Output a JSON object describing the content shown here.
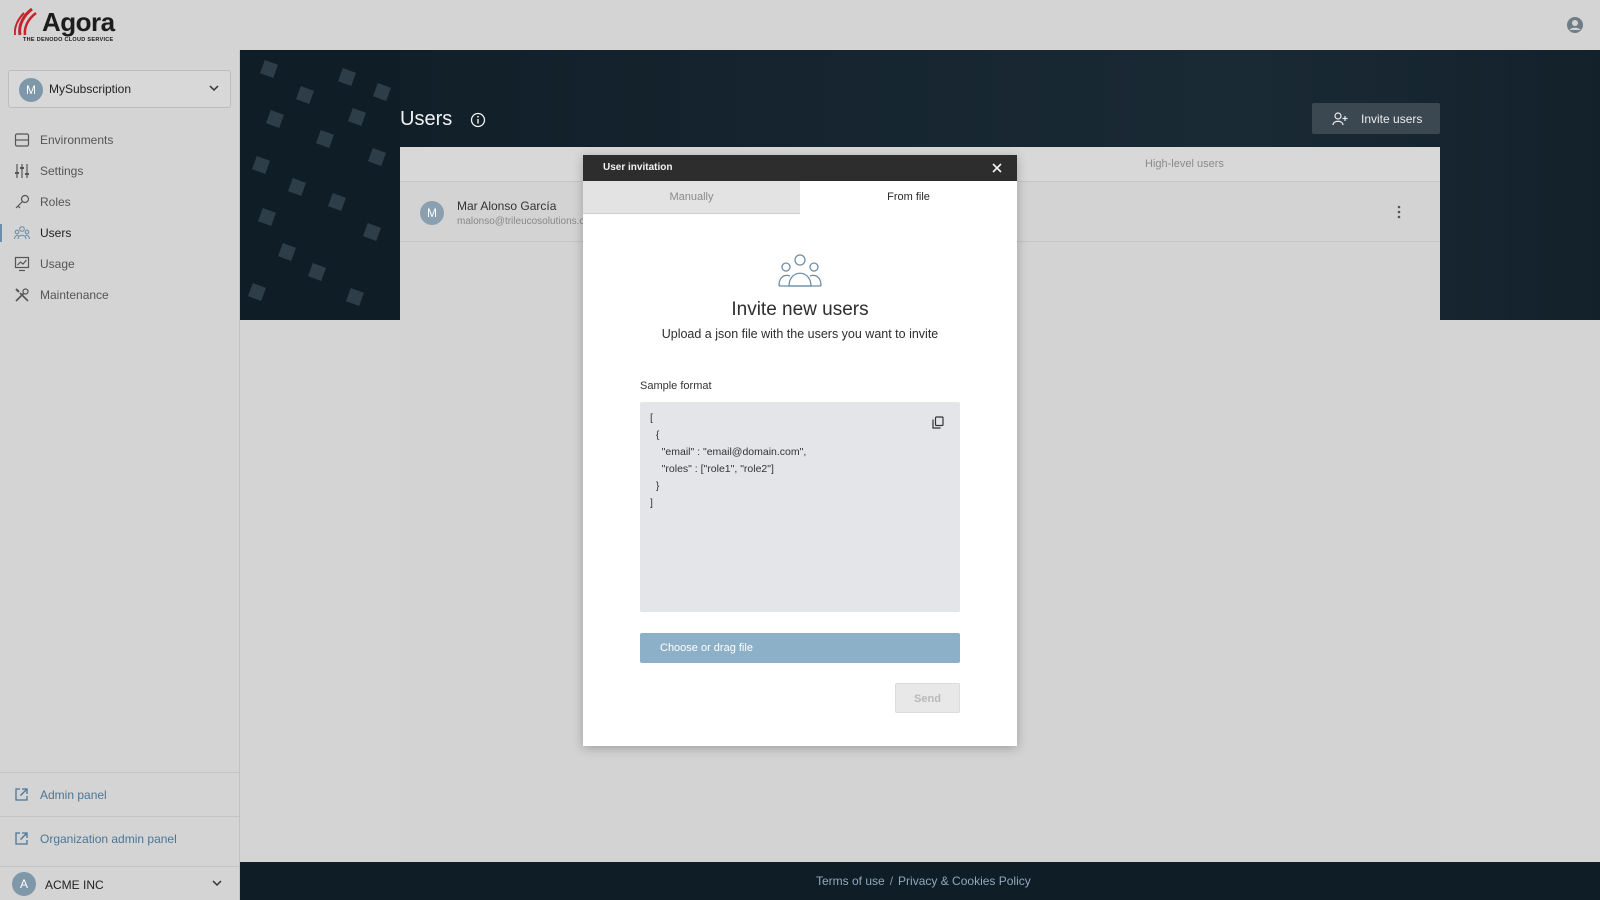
{
  "app": {
    "name": "Agora",
    "tagline": "THE DENODO CLOUD SERVICE"
  },
  "subscription": {
    "avatar": "M",
    "name": "MySubscription"
  },
  "sidebar": {
    "items": [
      {
        "label": "Environments",
        "icon": "environments-icon"
      },
      {
        "label": "Settings",
        "icon": "settings-sliders-icon"
      },
      {
        "label": "Roles",
        "icon": "key-icon"
      },
      {
        "label": "Users",
        "icon": "users-icon",
        "active": true
      },
      {
        "label": "Usage",
        "icon": "usage-chart-icon"
      },
      {
        "label": "Maintenance",
        "icon": "tools-icon"
      }
    ],
    "admin_panel": "Admin panel",
    "org_admin_panel": "Organization admin panel",
    "org": {
      "avatar": "A",
      "name": "ACME INC"
    }
  },
  "main": {
    "title": "Users",
    "invite_button": "Invite users",
    "tabs": {
      "right": "High-level users"
    },
    "users": [
      {
        "avatar": "M",
        "name": "Mar Alonso García",
        "email": "malonso@trileucosolutions.com"
      }
    ]
  },
  "footer": {
    "terms": "Terms of use",
    "separator": "/",
    "privacy": "Privacy & Cookies Policy"
  },
  "modal": {
    "title": "User invitation",
    "tabs": {
      "manual": "Manually",
      "file": "From file"
    },
    "heading": "Invite new users",
    "subheading": "Upload a json file with the users you want to invite",
    "sample_label": "Sample format",
    "code_lines": [
      "[",
      "  {",
      "    \"email\" : \"email@domain.com\",",
      "    \"roles\" : [\"role1\", \"role2\"]",
      "  }",
      "]"
    ],
    "file_button": "Choose or drag file",
    "send_button": "Send"
  },
  "colors": {
    "accent": "#6d8ea8",
    "link": "#4a7696",
    "dark": "#0f1d27",
    "file_button": "#8cb0c7"
  }
}
